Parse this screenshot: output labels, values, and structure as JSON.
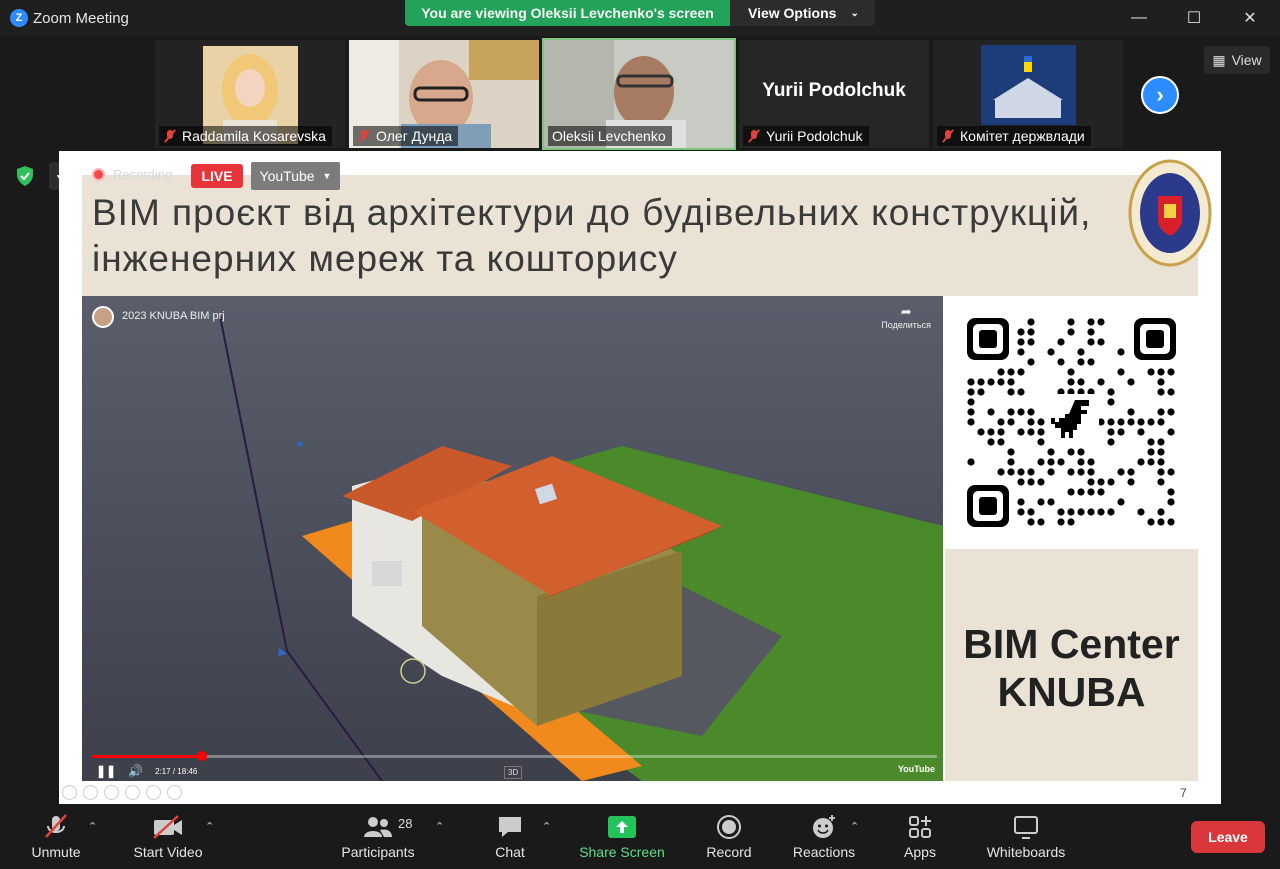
{
  "window": {
    "title": "Zoom Meeting",
    "logo": "Z"
  },
  "banner": {
    "viewing": "You are viewing Oleksii Levchenko's screen",
    "view_options": "View Options"
  },
  "gallery": {
    "tiles": [
      {
        "name": "Raddamila Kosarevska",
        "muted": true
      },
      {
        "name": "Олег Дунда",
        "muted": true
      },
      {
        "name": "Oleksii Levchenko",
        "muted": false
      },
      {
        "name": "Yurii Podolchuk",
        "muted": true,
        "big_name": "Yurii Podolchuk"
      },
      {
        "name": "Комітет держвлади",
        "muted": true
      }
    ],
    "view_label": "View"
  },
  "share": {
    "recording_label": "Recording",
    "live_label": "LIVE",
    "stream_label": "YouTube",
    "slide_title": "ВІМ проєкт від архітектури до будівельних конструкцій, інженерних мереж та кошторису",
    "video_title": "2023 KNUBA BIM prj",
    "video_share": "Поделиться",
    "video_time": "2:17 / 18:46",
    "video_progress_fraction": 0.13,
    "video_badge": "3D",
    "video_logo": "YouTube",
    "center_line1": "BIM Center",
    "center_line2": "KNUBA",
    "page_number": "7"
  },
  "toolbar": {
    "unmute": "Unmute",
    "start_video": "Start Video",
    "participants": "Participants",
    "participants_count": "28",
    "chat": "Chat",
    "share_screen": "Share Screen",
    "record": "Record",
    "reactions": "Reactions",
    "apps": "Apps",
    "whiteboards": "Whiteboards",
    "leave": "Leave"
  },
  "colors": {
    "accent": "#2d8cff",
    "share_green": "#23a35a",
    "leave_red": "#d9373c",
    "live_red": "#e8353b"
  }
}
